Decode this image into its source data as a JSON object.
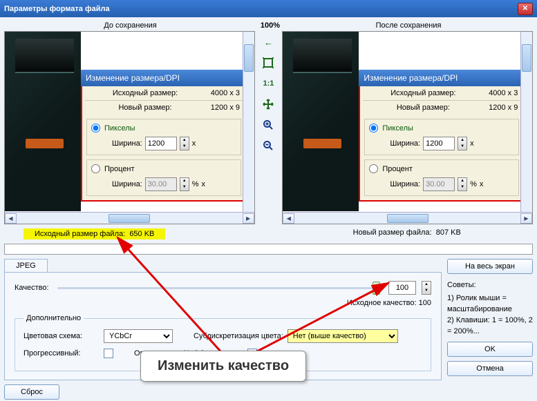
{
  "window_title": "Параметры формата файла",
  "labels": {
    "before_save": "До сохранения",
    "after_save": "После сохранения",
    "zoom": "100%",
    "one_to_one": "1:1",
    "orig_file_size_label": "Исходный размер файла:",
    "orig_file_size_value": "650 KB",
    "new_file_size_label": "Новый размер файла:",
    "new_file_size_value": "807 KB",
    "quality": "Качество:",
    "quality_value": "100",
    "orig_quality": "Исходное качество: 100",
    "additional": "Дополнительно",
    "color_scheme": "Цветовая схема:",
    "color_scheme_value": "YCbCr",
    "subsampling": "Субдискретизация цвета:",
    "subsampling_value": "Нет (выше качество)",
    "progressive": "Прогрессивный:",
    "huffman": "Оптимизация Хаффмана:",
    "tab_jpeg": "JPEG",
    "btn_fullscreen": "На весь экран",
    "btn_reset": "Сброс",
    "btn_ok": "OK",
    "btn_cancel": "Отмена",
    "tips_header": "Советы:",
    "tip1": "1) Ролик мыши = масштабирование",
    "tip2": "2) Клавиши: 1 = 100%, 2 = 200%..."
  },
  "inner_dialog": {
    "title": "Изменение размера/DPI",
    "orig_size_label": "Исходный размер:",
    "orig_size_value": "4000 x 3",
    "new_size_label": "Новый размер:",
    "new_size_value": "1200 x 9",
    "pixels": "Пикселы",
    "percent": "Процент",
    "width_label": "Ширина:",
    "width_value_px": "1200",
    "width_value_pct": "30.00",
    "x": "x",
    "pct_sign": "%"
  },
  "callout": "Изменить качество"
}
